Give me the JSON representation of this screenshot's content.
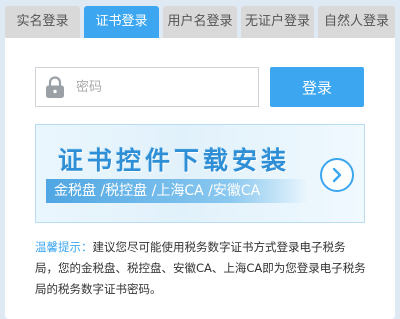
{
  "tabs": [
    {
      "label": "实名登录"
    },
    {
      "label": "证书登录"
    },
    {
      "label": "用户名登录"
    },
    {
      "label": "无证户登录"
    },
    {
      "label": "自然人登录"
    }
  ],
  "active_tab": "证书登录",
  "password": {
    "placeholder": "密码",
    "value": ""
  },
  "login_button": {
    "label": "登录"
  },
  "banner": {
    "title": "证书控件下载安装",
    "subtitle": "金税盘 /税控盘 /上海CA /安徽CA",
    "arrow_icon": "chevron-right-icon"
  },
  "tip": {
    "label": "温馨提示：",
    "text": "建议您尽可能使用税务数字证书方式登录电子税务局，您的金税盘、税控盘、安徽CA、上海CA即为您登录电子税务局的税务数字证书密码。"
  },
  "colors": {
    "accent": "#3ca6f0",
    "tab_inactive": "#d9d9d9",
    "page_background": "#dfe9f3"
  }
}
